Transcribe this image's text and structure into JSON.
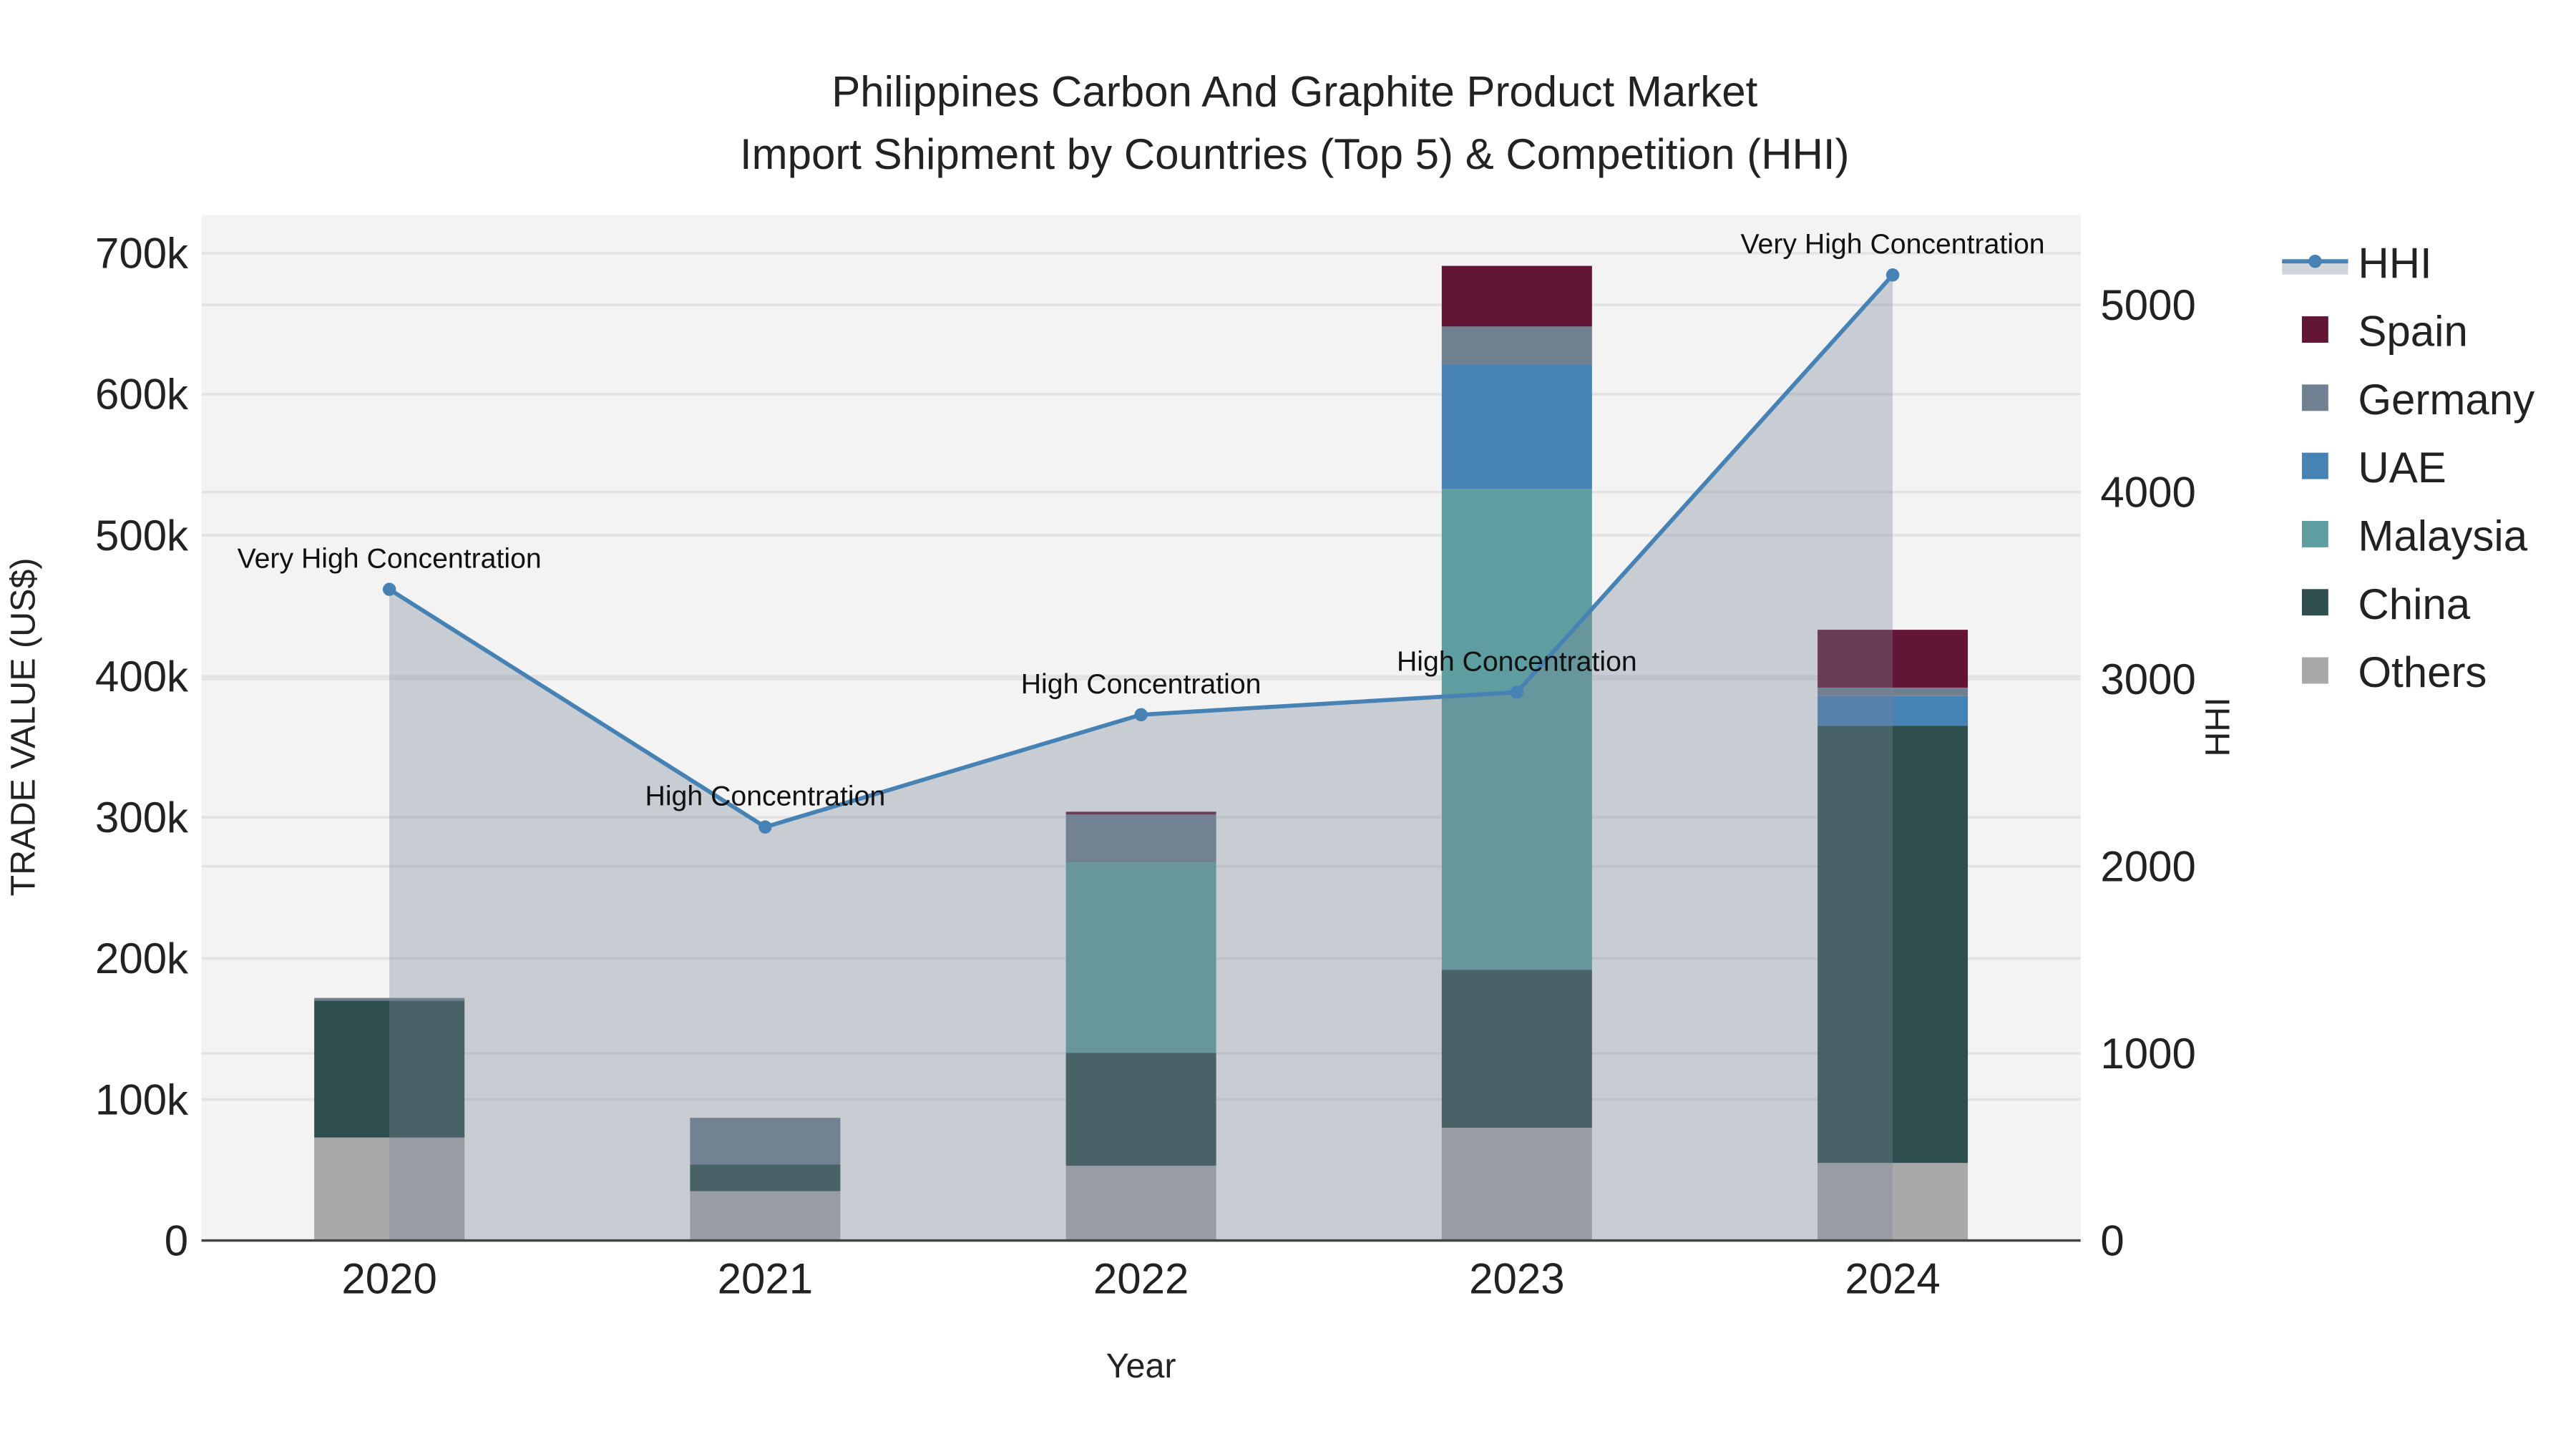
{
  "chart_data": {
    "type": "bar",
    "title_line1": "Philippines Carbon And Graphite Product Market",
    "title_line2": "Import Shipment by Countries (Top 5) & Competition (HHI)",
    "xlabel": "Year",
    "ylabel": "TRADE VALUE (US$)",
    "y2label": "HHI",
    "categories": [
      "2020",
      "2021",
      "2022",
      "2023",
      "2024"
    ],
    "ylim": [
      0,
      727000
    ],
    "y2lim": [
      0,
      5480
    ],
    "yticks": [
      0,
      100000,
      200000,
      300000,
      400000,
      500000,
      600000,
      700000
    ],
    "ytick_labels": [
      "0",
      "100k",
      "200k",
      "300k",
      "400k",
      "500k",
      "600k",
      "700k"
    ],
    "y2ticks": [
      0,
      1000,
      2000,
      3000,
      4000,
      5000
    ],
    "y2tick_labels": [
      "0",
      "1000",
      "2000",
      "3000",
      "4000",
      "5000"
    ],
    "series": [
      {
        "name": "Others",
        "color": "#A9A9A9",
        "values": [
          73000,
          35000,
          53000,
          80000,
          55000
        ]
      },
      {
        "name": "China",
        "color": "#2F4F4F",
        "values": [
          97000,
          19000,
          80000,
          112000,
          310000
        ]
      },
      {
        "name": "Malaysia",
        "color": "#5F9EA0",
        "values": [
          0,
          0,
          135000,
          341000,
          0
        ]
      },
      {
        "name": "UAE",
        "color": "#4682B4",
        "values": [
          0,
          0,
          0,
          88000,
          21000
        ]
      },
      {
        "name": "Germany",
        "color": "#708090",
        "values": [
          2000,
          33000,
          34000,
          27000,
          6000
        ]
      },
      {
        "name": "Spain",
        "color": "#631536",
        "values": [
          0,
          0,
          2000,
          43000,
          41000
        ]
      }
    ],
    "hhi": {
      "name": "HHI",
      "color": "#4682B4",
      "values": [
        3480,
        2210,
        2810,
        2930,
        5160
      ],
      "annotations": [
        "Very High Concentration",
        "High Concentration",
        "High Concentration",
        "High Concentration",
        "Very High Concentration"
      ]
    },
    "legend_order": [
      "HHI",
      "Spain",
      "Germany",
      "UAE",
      "Malaysia",
      "China",
      "Others"
    ],
    "legend_position": "right",
    "grid": true
  }
}
